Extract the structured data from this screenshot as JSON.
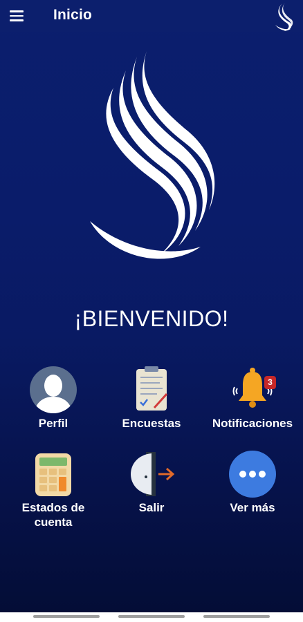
{
  "appbar": {
    "title": "Inicio",
    "menu_icon": "hamburger-menu-icon",
    "logo": "brand-swirl-logo"
  },
  "hero": {
    "logo": "brand-swirl-logo",
    "welcome_text": "¡BIENVENIDO!"
  },
  "menu": [
    {
      "label": "Perfil",
      "icon": "user-avatar-icon"
    },
    {
      "label": "Encuestas",
      "icon": "survey-clipboard-icon"
    },
    {
      "label": "Notificaciones",
      "icon": "bell-icon",
      "badge": "3"
    },
    {
      "label": "Estados de cuenta",
      "icon": "calculator-icon"
    },
    {
      "label": "Salir",
      "icon": "exit-door-icon"
    },
    {
      "label": "Ver más",
      "icon": "more-dots-icon"
    }
  ],
  "colors": {
    "background_top": "#0b1f6e",
    "background_bottom": "#040d36",
    "badge": "#c62828",
    "bell": "#f5a623",
    "more_button": "#3d7be0"
  }
}
